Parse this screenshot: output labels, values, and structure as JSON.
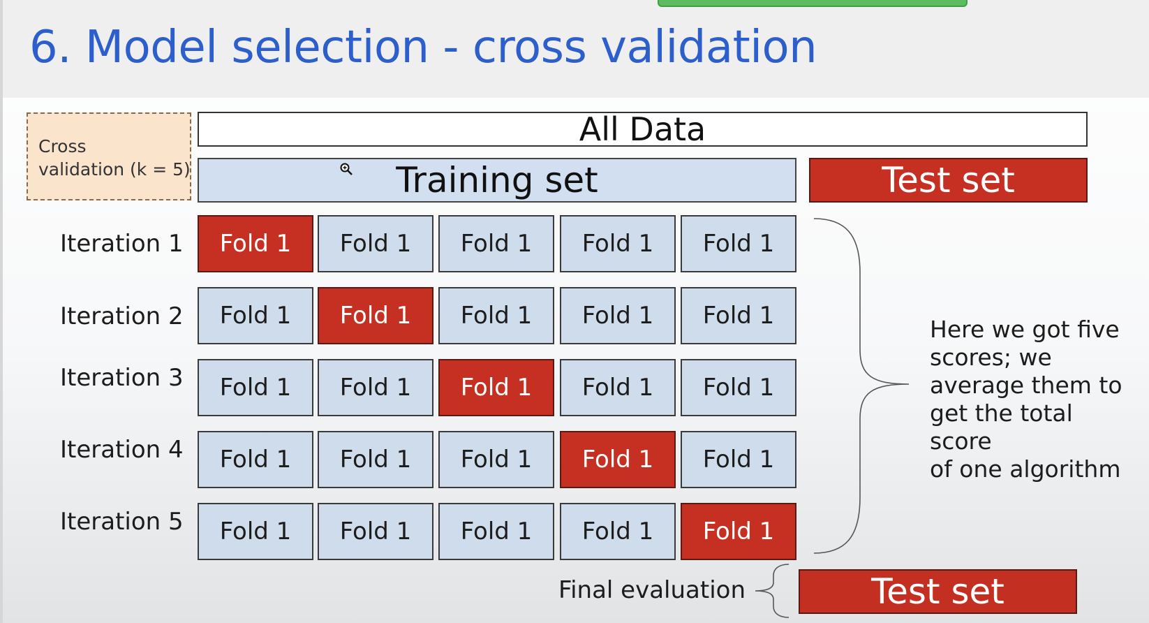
{
  "title": "6. Model selection - cross validation",
  "cv_note": {
    "line1": "Cross",
    "line2": "validation (k = 5)"
  },
  "all_data_label": "All Data",
  "training_set_label": "Training set",
  "test_set_label": "Test set",
  "iterations": [
    {
      "label": "Iteration 1",
      "held_out_fold": 1,
      "folds": [
        "Fold 1",
        "Fold 1",
        "Fold 1",
        "Fold 1",
        "Fold 1"
      ]
    },
    {
      "label": "Iteration 2",
      "held_out_fold": 2,
      "folds": [
        "Fold 1",
        "Fold 1",
        "Fold 1",
        "Fold 1",
        "Fold 1"
      ]
    },
    {
      "label": "Iteration 3",
      "held_out_fold": 3,
      "folds": [
        "Fold 1",
        "Fold 1",
        "Fold 1",
        "Fold 1",
        "Fold 1"
      ]
    },
    {
      "label": "Iteration 4",
      "held_out_fold": 4,
      "folds": [
        "Fold 1",
        "Fold 1",
        "Fold 1",
        "Fold 1",
        "Fold 1"
      ]
    },
    {
      "label": "Iteration 5",
      "held_out_fold": 5,
      "folds": [
        "Fold 1",
        "Fold 1",
        "Fold 1",
        "Fold 1",
        "Fold 1"
      ]
    }
  ],
  "score_note": {
    "line1": "Here we got five",
    "line2": "scores; we",
    "line3": "average them to",
    "line4": "get the total score",
    "line5": "of one algorithm"
  },
  "final_evaluation_label": "Final evaluation",
  "final_test_set_label": "Test set",
  "colors": {
    "title": "#2d5fcc",
    "held_out_fold": "#c63022",
    "training_fold": "#cfdcec",
    "cv_note_fill": "#fbe4cc"
  },
  "icons": {
    "cursor": "zoom-cursor-icon"
  }
}
